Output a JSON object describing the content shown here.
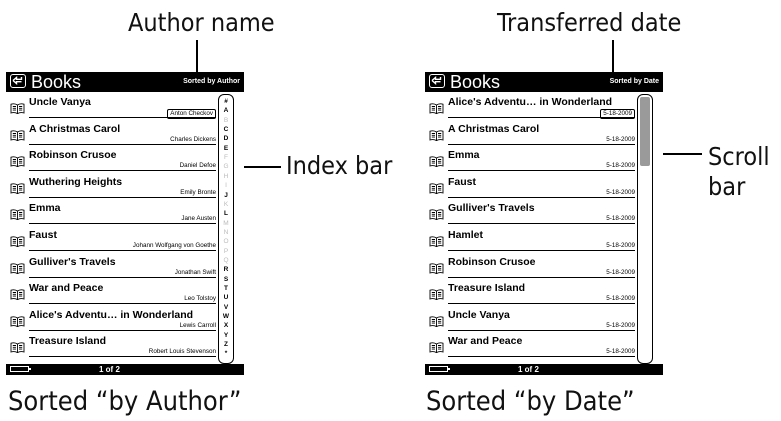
{
  "callouts": {
    "author_name": "Author name",
    "index_bar": "Index bar",
    "transferred_date": "Transferred date",
    "scroll_bar": "Scroll\nbar",
    "scroll_bar_1": "Scroll",
    "scroll_bar_2": "bar"
  },
  "captions": {
    "left": "Sorted “by Author”",
    "right": "Sorted “by Date”"
  },
  "left_screen": {
    "title": "Books",
    "sort_label": "Sorted by Author",
    "page": "1 of 2",
    "items": [
      {
        "title": "Uncle Vanya",
        "sub": "Anton Checkov"
      },
      {
        "title": "A Christmas Carol",
        "sub": "Charles Dickens"
      },
      {
        "title": "Robinson Crusoe",
        "sub": "Daniel Defoe"
      },
      {
        "title": "Wuthering Heights",
        "sub": "Emily Bronte"
      },
      {
        "title": "Emma",
        "sub": "Jane Austen"
      },
      {
        "title": "Faust",
        "sub": "Johann Wolfgang von Goethe"
      },
      {
        "title": "Gulliver's Travels",
        "sub": "Jonathan Swift"
      },
      {
        "title": "War and Peace",
        "sub": "Leo Tolstoy"
      },
      {
        "title": "Alice's Adventu… in Wonderland",
        "sub": "Lewis Carroll"
      },
      {
        "title": "Treasure Island",
        "sub": "Robert Louis Stevenson"
      }
    ],
    "index": [
      {
        "c": "#",
        "on": true
      },
      {
        "c": "A",
        "on": true
      },
      {
        "c": "B",
        "on": false
      },
      {
        "c": "C",
        "on": true
      },
      {
        "c": "D",
        "on": true
      },
      {
        "c": "E",
        "on": true
      },
      {
        "c": "F",
        "on": false
      },
      {
        "c": "G",
        "on": false
      },
      {
        "c": "H",
        "on": false
      },
      {
        "c": "I",
        "on": false
      },
      {
        "c": "J",
        "on": true
      },
      {
        "c": "K",
        "on": false
      },
      {
        "c": "L",
        "on": true
      },
      {
        "c": "M",
        "on": false
      },
      {
        "c": "N",
        "on": false
      },
      {
        "c": "O",
        "on": false
      },
      {
        "c": "P",
        "on": false
      },
      {
        "c": "Q",
        "on": false
      },
      {
        "c": "R",
        "on": true
      },
      {
        "c": "S",
        "on": true
      },
      {
        "c": "T",
        "on": true
      },
      {
        "c": "U",
        "on": true
      },
      {
        "c": "V",
        "on": true
      },
      {
        "c": "W",
        "on": true
      },
      {
        "c": "X",
        "on": true
      },
      {
        "c": "Y",
        "on": true
      },
      {
        "c": "Z",
        "on": true
      },
      {
        "c": "*",
        "on": true
      }
    ]
  },
  "right_screen": {
    "title": "Books",
    "sort_label": "Sorted by Date",
    "page": "1 of 2",
    "scroll_position": 0.26,
    "items": [
      {
        "title": "Alice's Adventu… in Wonderland",
        "sub": "5-18-2009"
      },
      {
        "title": "A Christmas Carol",
        "sub": "5-18-2009"
      },
      {
        "title": "Emma",
        "sub": "5-18-2009"
      },
      {
        "title": "Faust",
        "sub": "5-18-2009"
      },
      {
        "title": "Gulliver's Travels",
        "sub": "5-18-2009"
      },
      {
        "title": "Hamlet",
        "sub": "5-18-2009"
      },
      {
        "title": "Robinson Crusoe",
        "sub": "5-18-2009"
      },
      {
        "title": "Treasure Island",
        "sub": "5-18-2009"
      },
      {
        "title": "Uncle Vanya",
        "sub": "5-18-2009"
      },
      {
        "title": "War and Peace",
        "sub": "5-18-2009"
      }
    ]
  }
}
